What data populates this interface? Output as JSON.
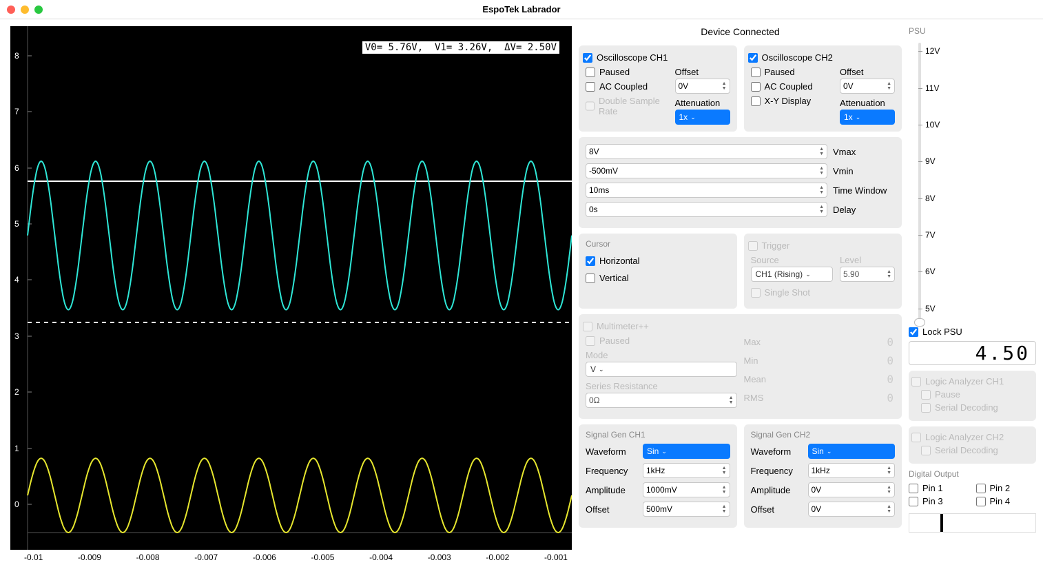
{
  "app_title": "EspoTek Labrador",
  "status": "Device Connected",
  "scope": {
    "overlay": "V0= 5.76V,  V1= 3.26V,  ΔV= 2.50V",
    "y_ticks": [
      "8",
      "7",
      "6",
      "5",
      "4",
      "3",
      "2",
      "1",
      "0"
    ],
    "x_ticks": [
      "-0.01",
      "-0.009",
      "-0.008",
      "-0.007",
      "-0.006",
      "-0.005",
      "-0.004",
      "-0.003",
      "-0.002",
      "-0.001"
    ]
  },
  "ch1": {
    "title": "Oscilloscope CH1",
    "paused": "Paused",
    "ac_coupled": "AC Coupled",
    "double_sample": "Double Sample Rate",
    "offset_label": "Offset",
    "offset_value": "0V",
    "atten_label": "Attenuation",
    "atten_value": "1x"
  },
  "ch2": {
    "title": "Oscilloscope CH2",
    "paused": "Paused",
    "ac_coupled": "AC Coupled",
    "xy": "X-Y Display",
    "offset_label": "Offset",
    "offset_value": "0V",
    "atten_label": "Attenuation",
    "atten_value": "1x"
  },
  "range": {
    "vmax_value": "8V",
    "vmax_label": "Vmax",
    "vmin_value": "-500mV",
    "vmin_label": "Vmin",
    "timewin_value": "10ms",
    "timewin_label": "Time Window",
    "delay_value": "0s",
    "delay_label": "Delay"
  },
  "cursor": {
    "title": "Cursor",
    "horizontal": "Horizontal",
    "vertical": "Vertical"
  },
  "trigger": {
    "title": "Trigger",
    "source_label": "Source",
    "source_value": "CH1 (Rising)",
    "level_label": "Level",
    "level_value": "5.90",
    "single_shot": "Single Shot"
  },
  "multimeter": {
    "title": "Multimeter++",
    "paused": "Paused",
    "mode_label": "Mode",
    "mode_value": "V",
    "series_res_label": "Series Resistance",
    "series_res_value": "0Ω",
    "max": "Max",
    "min": "Min",
    "mean": "Mean",
    "rms": "RMS",
    "digit": "0"
  },
  "sig1": {
    "title": "Signal Gen CH1",
    "waveform_label": "Waveform",
    "waveform_value": "Sin",
    "freq_label": "Frequency",
    "freq_value": "1kHz",
    "amp_label": "Amplitude",
    "amp_value": "1000mV",
    "offset_label": "Offset",
    "offset_value": "500mV"
  },
  "sig2": {
    "title": "Signal Gen CH2",
    "waveform_label": "Waveform",
    "waveform_value": "Sin",
    "freq_label": "Frequency",
    "freq_value": "1kHz",
    "amp_label": "Amplitude",
    "amp_value": "0V",
    "offset_label": "Offset",
    "offset_value": "0V"
  },
  "psu": {
    "title": "PSU",
    "ticks": [
      "12V",
      "11V",
      "10V",
      "9V",
      "8V",
      "7V",
      "6V",
      "5V"
    ],
    "lock": "Lock PSU",
    "value": "4.50"
  },
  "la1": {
    "title": "Logic Analyzer CH1",
    "pause": "Pause",
    "serial": "Serial Decoding"
  },
  "la2": {
    "title": "Logic Analyzer CH2",
    "serial": "Serial Decoding"
  },
  "digital": {
    "title": "Digital Output",
    "pin1": "Pin 1",
    "pin2": "Pin 2",
    "pin3": "Pin 3",
    "pin4": "Pin 4"
  },
  "chart_data": {
    "type": "line",
    "xlabel": "",
    "ylabel": "",
    "xlim": [
      -0.01,
      0
    ],
    "ylim": [
      -0.5,
      8
    ],
    "cursors": {
      "horizontal": [
        5.76,
        3.26
      ]
    },
    "series": [
      {
        "name": "CH1",
        "color": "#2ee6d6",
        "waveform": "sin",
        "frequency_hz": 1000,
        "amplitude_v": 1.25,
        "offset_v": 4.5,
        "min_v": 3.26,
        "max_v": 5.76
      },
      {
        "name": "CH2",
        "color": "#e6e62e",
        "waveform": "sin",
        "frequency_hz": 1000,
        "amplitude_v": 0.625,
        "offset_v": 0.125,
        "min_v": -0.5,
        "max_v": 0.75
      }
    ]
  }
}
